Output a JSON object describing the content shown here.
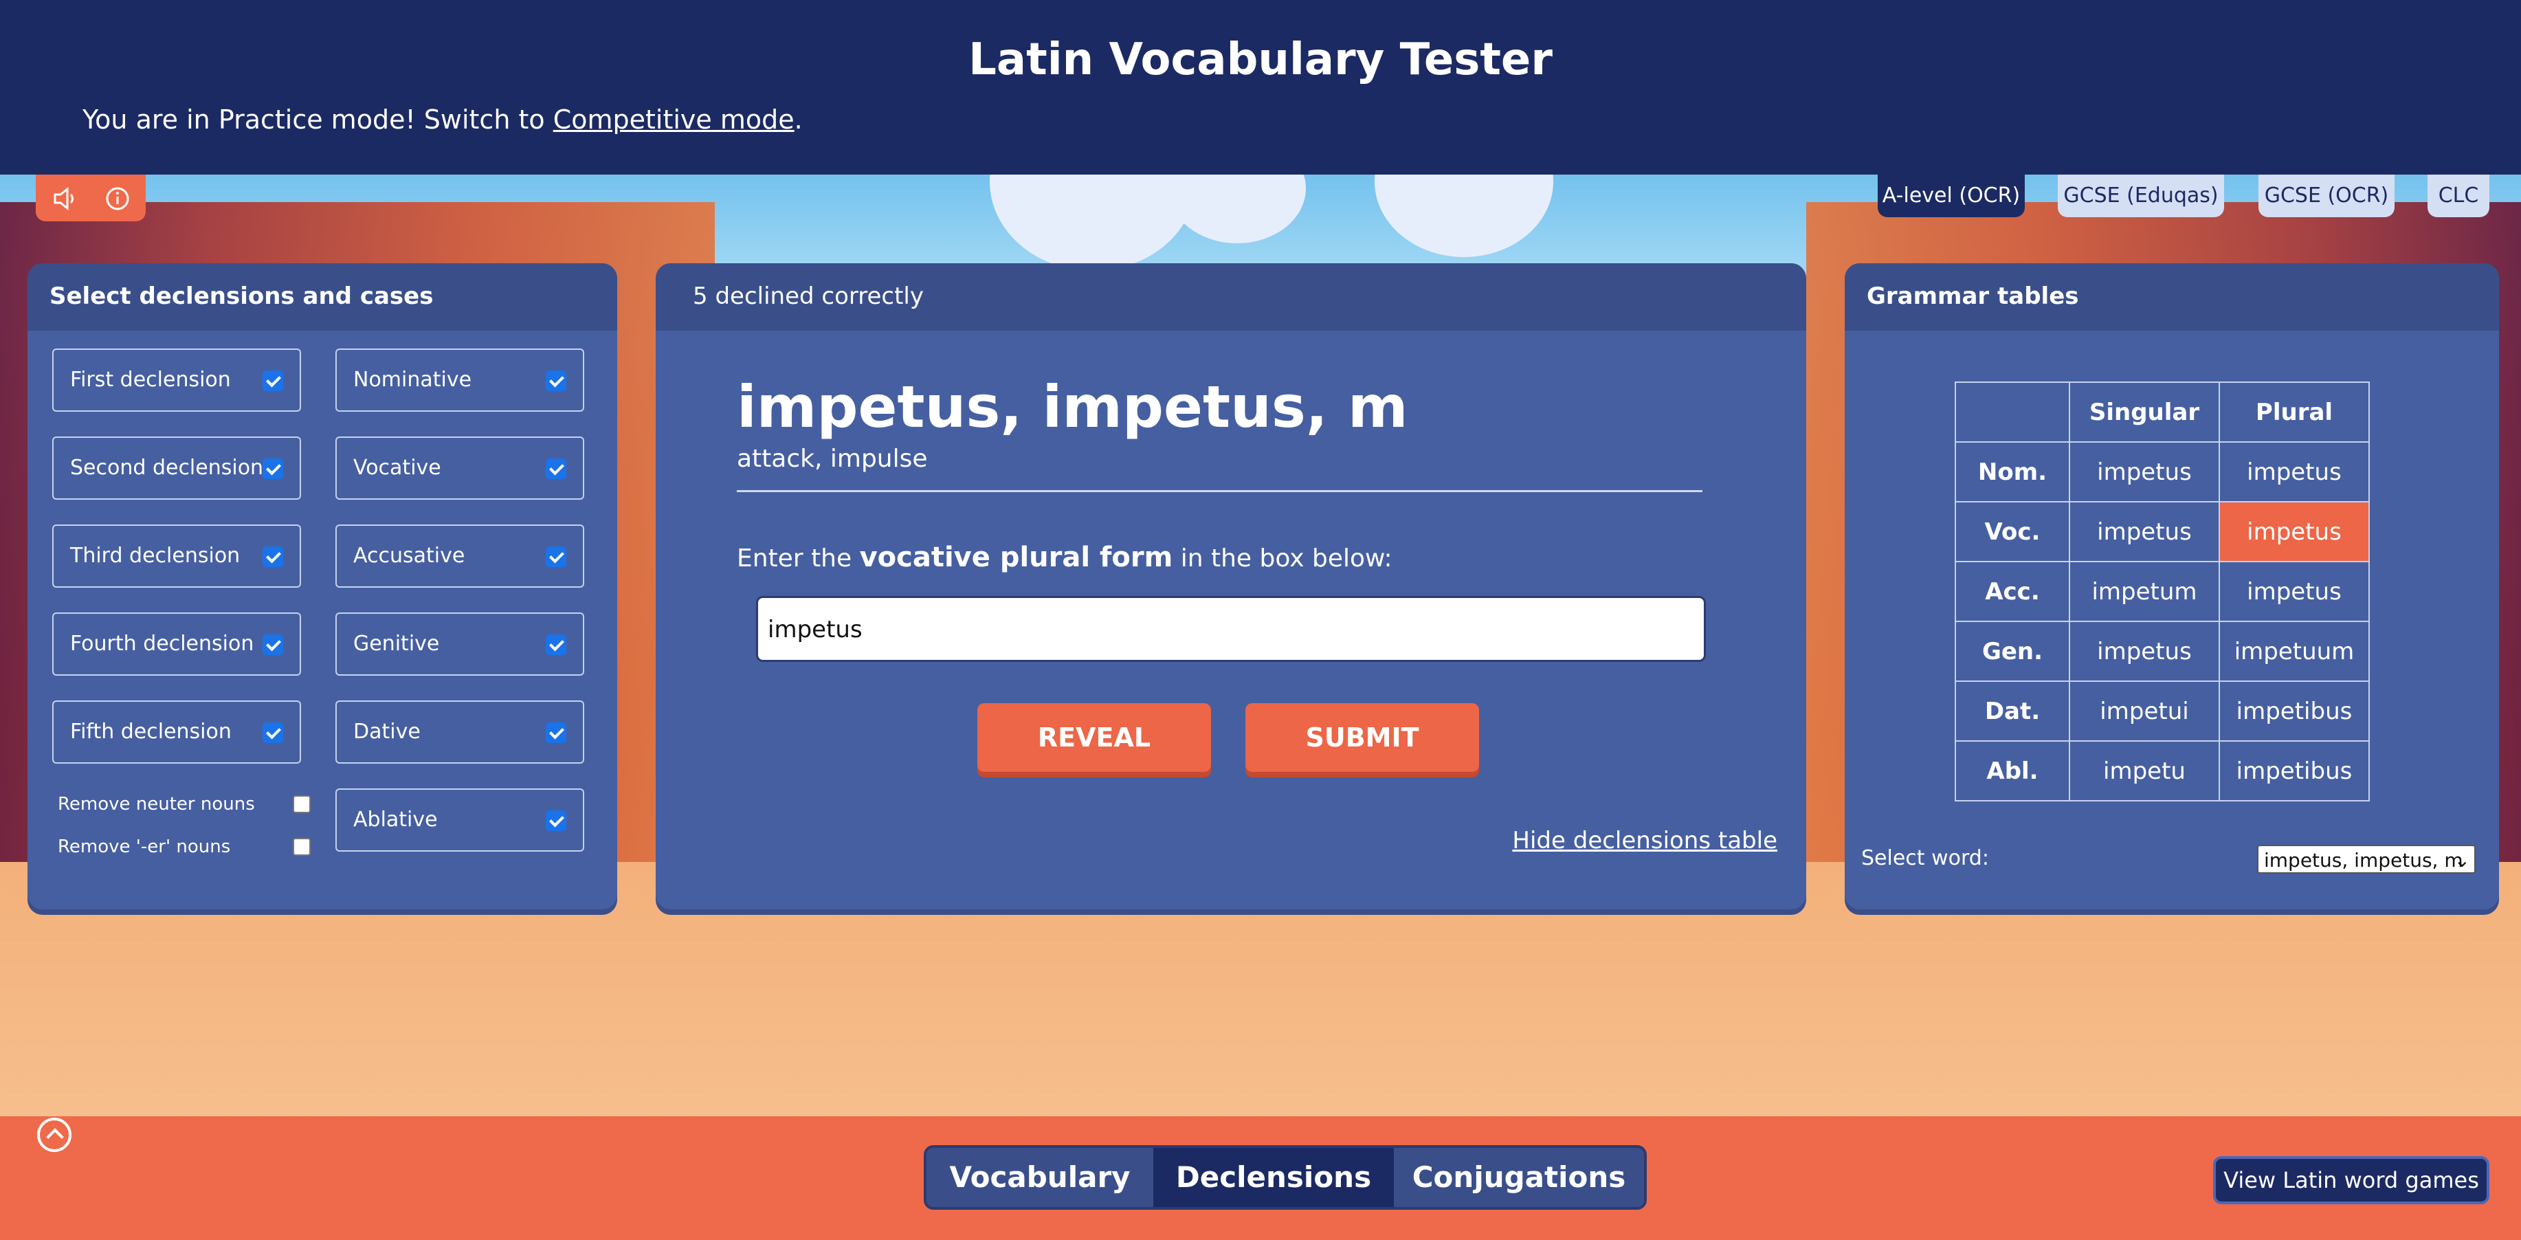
{
  "header": {
    "title": "Latin Vocabulary Tester",
    "mode_text": "You are in Practice mode! Switch to ",
    "mode_link": "Competitive mode",
    "mode_end": "."
  },
  "toolbar": {
    "sound_icon": "speaker-icon",
    "info_icon": "info-icon"
  },
  "exam_tabs": [
    {
      "label": "A-level (OCR)",
      "active": true
    },
    {
      "label": "GCSE (Eduqas)",
      "active": false
    },
    {
      "label": "GCSE (OCR)",
      "active": false
    },
    {
      "label": "CLC",
      "active": false
    }
  ],
  "left_panel": {
    "title": "Select declensions and cases",
    "declensions": [
      "First declension",
      "Second declension",
      "Third declension",
      "Fourth declension",
      "Fifth declension"
    ],
    "cases": [
      "Nominative",
      "Vocative",
      "Accusative",
      "Genitive",
      "Dative",
      "Ablative"
    ],
    "remove_neuter": "Remove neuter nouns",
    "remove_er": "Remove '-er' nouns"
  },
  "center_panel": {
    "score": "5 declined correctly",
    "word": "impetus, impetus, m",
    "meaning": "attack, impulse",
    "prompt_pre": "Enter the ",
    "prompt_bold": "vocative plural form",
    "prompt_post": " in the box below:",
    "answer_value": "impetus",
    "reveal_label": "REVEAL",
    "submit_label": "SUBMIT",
    "hide_link": "Hide declensions table"
  },
  "grammar_panel": {
    "title": "Grammar tables",
    "columns": [
      "Singular",
      "Plural"
    ],
    "rows": [
      {
        "case": "Nom.",
        "singular": "impetus",
        "plural": "impetus"
      },
      {
        "case": "Voc.",
        "singular": "impetus",
        "plural": "impetus"
      },
      {
        "case": "Acc.",
        "singular": "impetum",
        "plural": "impetus"
      },
      {
        "case": "Gen.",
        "singular": "impetus",
        "plural": "impetuum"
      },
      {
        "case": "Dat.",
        "singular": "impetui",
        "plural": "impetibus"
      },
      {
        "case": "Abl.",
        "singular": "impetu",
        "plural": "impetibus"
      }
    ],
    "select_label": "Select word:",
    "select_value": "impetus, impetus, m"
  },
  "footer": {
    "tabs": [
      {
        "label": "Vocabulary",
        "active": false
      },
      {
        "label": "Declensions",
        "active": true
      },
      {
        "label": "Conjugations",
        "active": false
      }
    ],
    "games_button": "View Latin word games"
  },
  "colors": {
    "navy": "#1c2a63",
    "panel": "#465fa1",
    "accent": "#ec6647"
  }
}
